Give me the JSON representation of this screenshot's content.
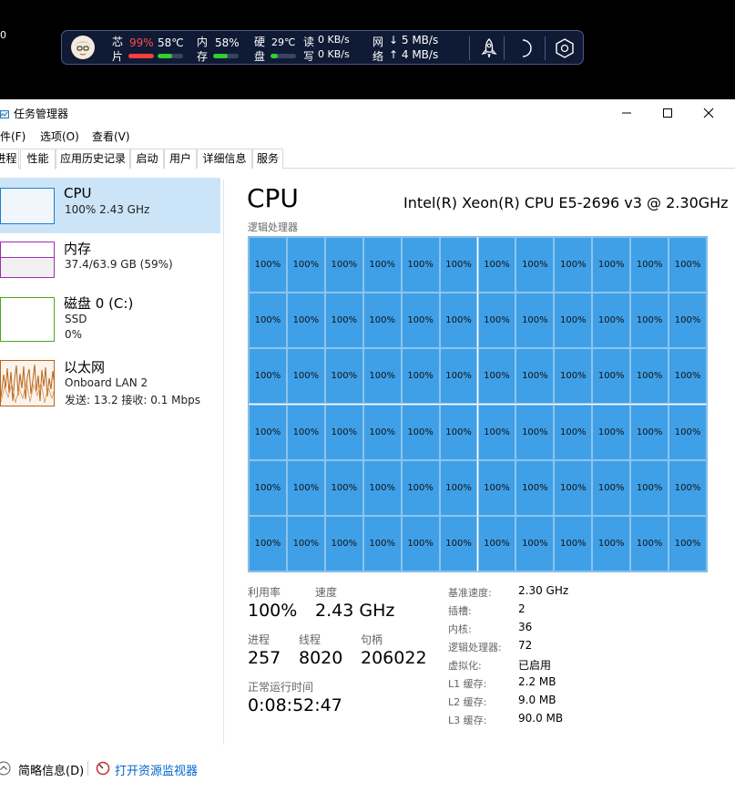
{
  "corner_text": "0",
  "widget": {
    "cpu": {
      "label_top": "芯",
      "label_bottom": "片",
      "usage": "99%",
      "usage_fraction": 0.99,
      "temp": "58℃",
      "temp_fraction": 0.58,
      "usage_color": "#ff3b3b",
      "temp_color": "#33cc33"
    },
    "mem": {
      "label_top": "内",
      "label_bottom": "存",
      "usage": "58%",
      "usage_fraction": 0.58,
      "bar_color": "#33cc33"
    },
    "disk": {
      "label_top": "硬",
      "label_bottom": "盘",
      "temp": "29℃",
      "temp_fraction": 0.29,
      "bar_color": "#33cc33"
    },
    "io": {
      "read_label": "读",
      "read": "0 KB/s",
      "write_label": "写",
      "write": "0 KB/s"
    },
    "net": {
      "label_top": "网",
      "label_bottom": "络",
      "down": "↓ 5 MB/s",
      "up": "↑ 4 MB/s"
    },
    "icons": [
      "avatar",
      "rocket-icon",
      "moon-icon",
      "hexagon-settings-icon"
    ]
  },
  "window": {
    "title": "任务管理器",
    "menu": [
      "文件(F)",
      "选项(O)",
      "查看(V)"
    ],
    "tabs": [
      "进程",
      "性能",
      "应用历史记录",
      "启动",
      "用户",
      "详细信息",
      "服务"
    ],
    "active_tab": "性能",
    "side": [
      {
        "title": "CPU",
        "line2": "100% 2.43 GHz",
        "line3": "",
        "color": "#1a7fd0",
        "selected": true
      },
      {
        "title": "内存",
        "line2": "37.4/63.9 GB (59%)",
        "line3": "",
        "color": "#9b2fae",
        "fill_fraction": 0.59
      },
      {
        "title": "磁盘 0 (C:)",
        "line2": "SSD",
        "line3": "0%",
        "color": "#4da81e"
      },
      {
        "title": "以太网",
        "line2": "Onboard LAN 2",
        "line3": "发送: 13.2 接收: 0.1 Mbps",
        "color": "#b8651a"
      }
    ],
    "cpu": {
      "title": "CPU",
      "model": "Intel(R) Xeon(R) CPU E5-2696 v3 @ 2.30GHz",
      "grid_label": "逻辑处理器",
      "grid_rows": 6,
      "grid_cols": 12,
      "cell_value": "100%",
      "stats": {
        "util_label": "利用率",
        "util": "100%",
        "speed_label": "速度",
        "speed": "2.43 GHz",
        "proc_label": "进程",
        "proc": "257",
        "threads_label": "线程",
        "threads": "8020",
        "handles_label": "句柄",
        "handles": "206022",
        "uptime_label": "正常运行时间",
        "uptime": "0:08:52:47"
      },
      "details": [
        {
          "k": "基准速度:",
          "v": "2.30 GHz"
        },
        {
          "k": "插槽:",
          "v": "2"
        },
        {
          "k": "内核:",
          "v": "36"
        },
        {
          "k": "逻辑处理器:",
          "v": "72"
        },
        {
          "k": "虚拟化:",
          "v": "已启用"
        },
        {
          "k": "L1 缓存:",
          "v": "2.2 MB"
        },
        {
          "k": "L2 缓存:",
          "v": "9.0 MB"
        },
        {
          "k": "L3 缓存:",
          "v": "90.0 MB"
        }
      ]
    },
    "footer": {
      "less": "简略信息(D)",
      "monitor": "打开资源监视器"
    }
  }
}
